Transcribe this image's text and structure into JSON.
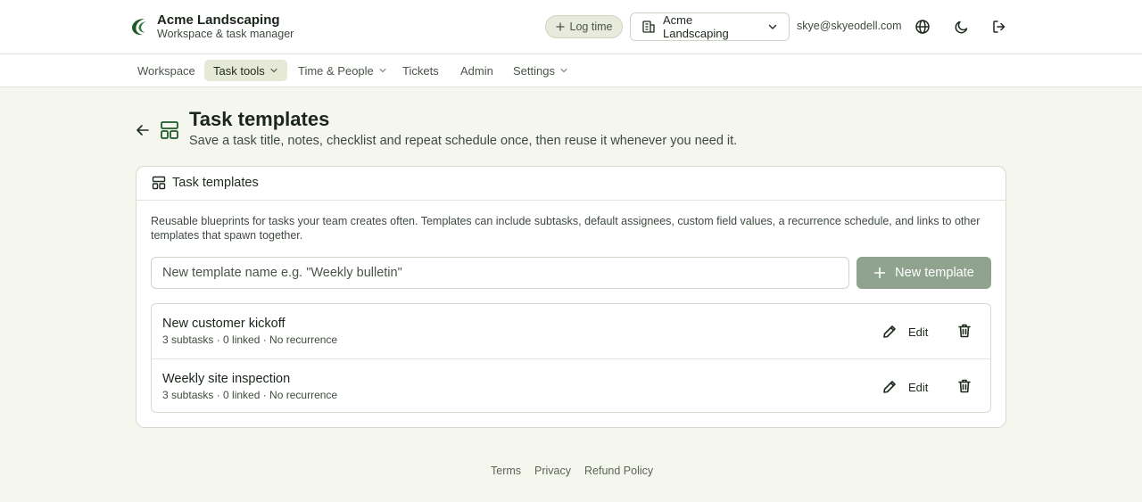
{
  "header": {
    "brand_name": "Acme Landscaping",
    "brand_subtitle": "Workspace & task manager",
    "log_time_label": "Log time",
    "workspace_selected": "Acme Landscaping",
    "user_email": "skye@skyeodell.com"
  },
  "nav": {
    "items": [
      {
        "label": "Workspace"
      },
      {
        "label": "Task tools"
      },
      {
        "label": "Time & People"
      },
      {
        "label": "Tickets"
      },
      {
        "label": "Admin"
      },
      {
        "label": "Settings"
      }
    ],
    "active": "Task tools"
  },
  "page": {
    "title": "Task templates",
    "subtitle": "Save a task title, notes, checklist and repeat schedule once, then reuse it whenever you need it."
  },
  "card": {
    "title": "Task templates",
    "description": "Reusable blueprints for tasks your team creates often. Templates can include subtasks, default assignees, custom field values, a recurrence schedule, and links to other templates that spawn together.",
    "input_placeholder": "New template name e.g. \"Weekly bulletin\"",
    "input_value": "",
    "new_button_label": "New template",
    "templates": [
      {
        "name": "New customer kickoff",
        "meta": "3 subtasks · 0 linked · No recurrence",
        "edit_label": "Edit"
      },
      {
        "name": "Weekly site inspection",
        "meta": "3 subtasks · 0 linked · No recurrence",
        "edit_label": "Edit"
      }
    ]
  },
  "footer": {
    "links": [
      {
        "label": "Terms"
      },
      {
        "label": "Privacy"
      },
      {
        "label": "Refund Policy"
      }
    ]
  },
  "colors": {
    "accent": "#1e5a2b",
    "page_background": "#f5f7ef",
    "primary_button": "#8fa38f"
  }
}
